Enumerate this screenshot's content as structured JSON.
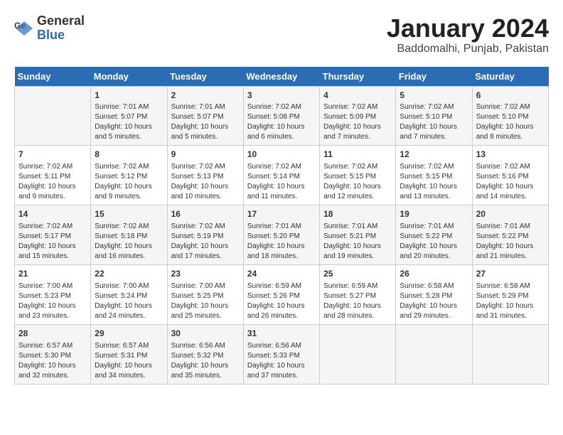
{
  "header": {
    "logo_line1": "General",
    "logo_line2": "Blue",
    "title": "January 2024",
    "subtitle": "Baddomalhi, Punjab, Pakistan"
  },
  "calendar": {
    "headers": [
      "Sunday",
      "Monday",
      "Tuesday",
      "Wednesday",
      "Thursday",
      "Friday",
      "Saturday"
    ],
    "weeks": [
      [
        {
          "day": "",
          "info": ""
        },
        {
          "day": "1",
          "info": "Sunrise: 7:01 AM\nSunset: 5:07 PM\nDaylight: 10 hours\nand 5 minutes."
        },
        {
          "day": "2",
          "info": "Sunrise: 7:01 AM\nSunset: 5:07 PM\nDaylight: 10 hours\nand 5 minutes."
        },
        {
          "day": "3",
          "info": "Sunrise: 7:02 AM\nSunset: 5:08 PM\nDaylight: 10 hours\nand 6 minutes."
        },
        {
          "day": "4",
          "info": "Sunrise: 7:02 AM\nSunset: 5:09 PM\nDaylight: 10 hours\nand 7 minutes."
        },
        {
          "day": "5",
          "info": "Sunrise: 7:02 AM\nSunset: 5:10 PM\nDaylight: 10 hours\nand 7 minutes."
        },
        {
          "day": "6",
          "info": "Sunrise: 7:02 AM\nSunset: 5:10 PM\nDaylight: 10 hours\nand 8 minutes."
        }
      ],
      [
        {
          "day": "7",
          "info": "Sunrise: 7:02 AM\nSunset: 5:11 PM\nDaylight: 10 hours\nand 9 minutes."
        },
        {
          "day": "8",
          "info": "Sunrise: 7:02 AM\nSunset: 5:12 PM\nDaylight: 10 hours\nand 9 minutes."
        },
        {
          "day": "9",
          "info": "Sunrise: 7:02 AM\nSunset: 5:13 PM\nDaylight: 10 hours\nand 10 minutes."
        },
        {
          "day": "10",
          "info": "Sunrise: 7:02 AM\nSunset: 5:14 PM\nDaylight: 10 hours\nand 11 minutes."
        },
        {
          "day": "11",
          "info": "Sunrise: 7:02 AM\nSunset: 5:15 PM\nDaylight: 10 hours\nand 12 minutes."
        },
        {
          "day": "12",
          "info": "Sunrise: 7:02 AM\nSunset: 5:15 PM\nDaylight: 10 hours\nand 13 minutes."
        },
        {
          "day": "13",
          "info": "Sunrise: 7:02 AM\nSunset: 5:16 PM\nDaylight: 10 hours\nand 14 minutes."
        }
      ],
      [
        {
          "day": "14",
          "info": "Sunrise: 7:02 AM\nSunset: 5:17 PM\nDaylight: 10 hours\nand 15 minutes."
        },
        {
          "day": "15",
          "info": "Sunrise: 7:02 AM\nSunset: 5:18 PM\nDaylight: 10 hours\nand 16 minutes."
        },
        {
          "day": "16",
          "info": "Sunrise: 7:02 AM\nSunset: 5:19 PM\nDaylight: 10 hours\nand 17 minutes."
        },
        {
          "day": "17",
          "info": "Sunrise: 7:01 AM\nSunset: 5:20 PM\nDaylight: 10 hours\nand 18 minutes."
        },
        {
          "day": "18",
          "info": "Sunrise: 7:01 AM\nSunset: 5:21 PM\nDaylight: 10 hours\nand 19 minutes."
        },
        {
          "day": "19",
          "info": "Sunrise: 7:01 AM\nSunset: 5:22 PM\nDaylight: 10 hours\nand 20 minutes."
        },
        {
          "day": "20",
          "info": "Sunrise: 7:01 AM\nSunset: 5:22 PM\nDaylight: 10 hours\nand 21 minutes."
        }
      ],
      [
        {
          "day": "21",
          "info": "Sunrise: 7:00 AM\nSunset: 5:23 PM\nDaylight: 10 hours\nand 23 minutes."
        },
        {
          "day": "22",
          "info": "Sunrise: 7:00 AM\nSunset: 5:24 PM\nDaylight: 10 hours\nand 24 minutes."
        },
        {
          "day": "23",
          "info": "Sunrise: 7:00 AM\nSunset: 5:25 PM\nDaylight: 10 hours\nand 25 minutes."
        },
        {
          "day": "24",
          "info": "Sunrise: 6:59 AM\nSunset: 5:26 PM\nDaylight: 10 hours\nand 26 minutes."
        },
        {
          "day": "25",
          "info": "Sunrise: 6:59 AM\nSunset: 5:27 PM\nDaylight: 10 hours\nand 28 minutes."
        },
        {
          "day": "26",
          "info": "Sunrise: 6:58 AM\nSunset: 5:28 PM\nDaylight: 10 hours\nand 29 minutes."
        },
        {
          "day": "27",
          "info": "Sunrise: 6:58 AM\nSunset: 5:29 PM\nDaylight: 10 hours\nand 31 minutes."
        }
      ],
      [
        {
          "day": "28",
          "info": "Sunrise: 6:57 AM\nSunset: 5:30 PM\nDaylight: 10 hours\nand 32 minutes."
        },
        {
          "day": "29",
          "info": "Sunrise: 6:57 AM\nSunset: 5:31 PM\nDaylight: 10 hours\nand 34 minutes."
        },
        {
          "day": "30",
          "info": "Sunrise: 6:56 AM\nSunset: 5:32 PM\nDaylight: 10 hours\nand 35 minutes."
        },
        {
          "day": "31",
          "info": "Sunrise: 6:56 AM\nSunset: 5:33 PM\nDaylight: 10 hours\nand 37 minutes."
        },
        {
          "day": "",
          "info": ""
        },
        {
          "day": "",
          "info": ""
        },
        {
          "day": "",
          "info": ""
        }
      ]
    ]
  }
}
